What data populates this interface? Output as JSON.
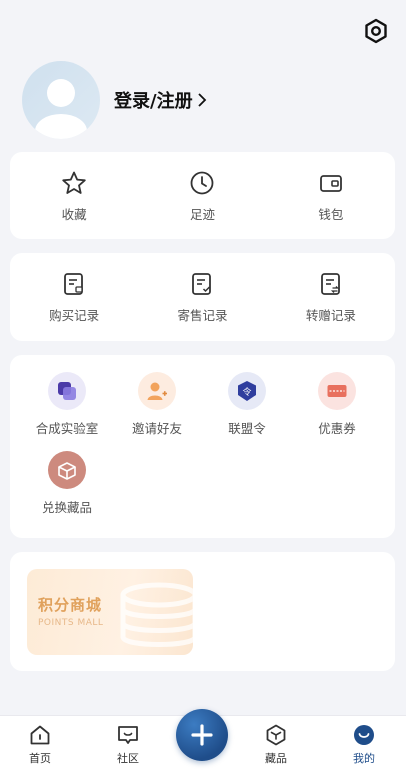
{
  "header": {
    "settings_icon": "gear-hexagon-icon"
  },
  "profile": {
    "login_label": "登录/注册",
    "avatar_icon": "default-avatar-icon"
  },
  "quick": [
    {
      "label": "收藏",
      "icon": "star-icon"
    },
    {
      "label": "足迹",
      "icon": "clock-icon"
    },
    {
      "label": "钱包",
      "icon": "wallet-icon"
    }
  ],
  "records": [
    {
      "label": "购买记录",
      "icon": "purchase-record-icon"
    },
    {
      "label": "寄售记录",
      "icon": "consign-record-icon"
    },
    {
      "label": "转赠记录",
      "icon": "transfer-record-icon"
    }
  ],
  "services": [
    {
      "label": "合成实验室",
      "icon": "synthesis-lab-icon"
    },
    {
      "label": "邀请好友",
      "icon": "invite-friend-icon"
    },
    {
      "label": "联盟令",
      "icon": "alliance-token-icon"
    },
    {
      "label": "优惠券",
      "icon": "coupon-icon"
    },
    {
      "label": "兑换藏品",
      "icon": "redeem-collection-icon"
    }
  ],
  "mall": {
    "title": "积分商城",
    "subtitle": "POINTS MALL"
  },
  "tabbar": [
    {
      "label": "首页",
      "icon": "home-icon"
    },
    {
      "label": "社区",
      "icon": "community-icon"
    },
    {
      "label": "",
      "icon": "plus-icon"
    },
    {
      "label": "藏品",
      "icon": "cube-icon"
    },
    {
      "label": "我的",
      "icon": "mine-icon"
    }
  ],
  "colors": {
    "active_tab": "#1f4d8a",
    "accent_orange": "#e0a15c",
    "background": "#f3f4f8"
  }
}
